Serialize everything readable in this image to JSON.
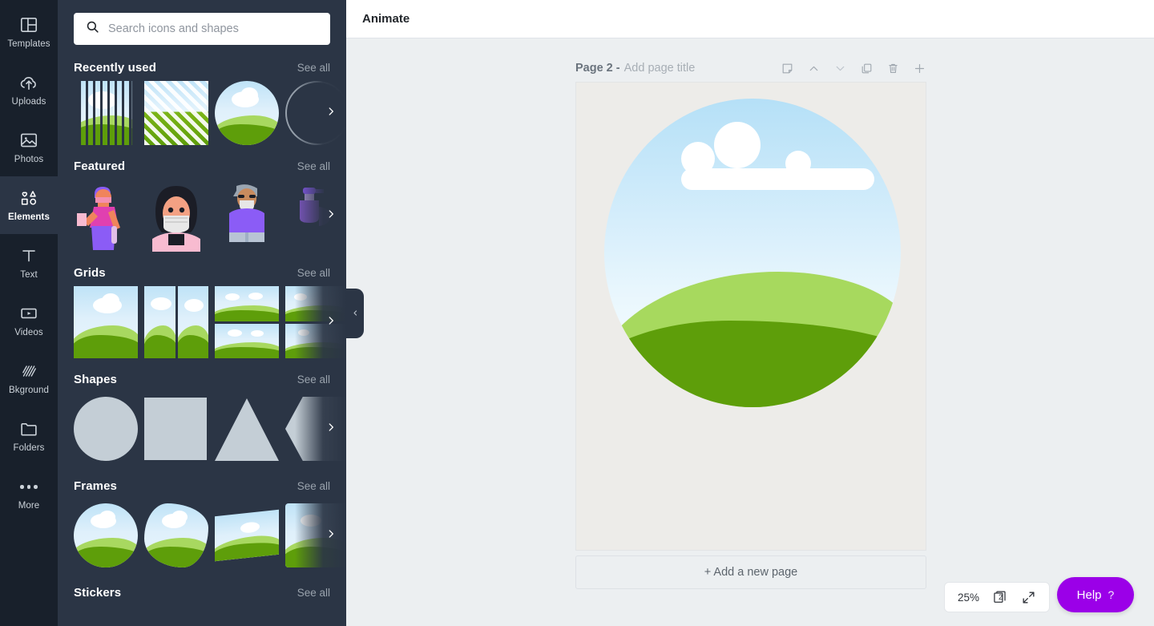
{
  "rail": {
    "items": [
      {
        "label": "Templates",
        "icon": "templates-icon",
        "active": false
      },
      {
        "label": "Uploads",
        "icon": "upload-cloud-icon",
        "active": false
      },
      {
        "label": "Photos",
        "icon": "photo-icon",
        "active": false
      },
      {
        "label": "Elements",
        "icon": "elements-shapes-icon",
        "active": true
      },
      {
        "label": "Text",
        "icon": "text-t-icon",
        "active": false
      },
      {
        "label": "Videos",
        "icon": "video-play-icon",
        "active": false
      },
      {
        "label": "Bkground",
        "icon": "background-hatch-icon",
        "active": false
      },
      {
        "label": "Folders",
        "icon": "folder-icon",
        "active": false
      },
      {
        "label": "More",
        "icon": "more-dots-icon",
        "active": false
      }
    ]
  },
  "panel": {
    "search": {
      "placeholder": "Search icons and shapes",
      "value": "",
      "icon": "search-icon"
    },
    "see_all_label": "See all",
    "sections": [
      {
        "title": "Recently used",
        "see_all": "See all"
      },
      {
        "title": "Featured",
        "see_all": "See all"
      },
      {
        "title": "Grids",
        "see_all": "See all"
      },
      {
        "title": "Shapes",
        "see_all": "See all"
      },
      {
        "title": "Frames",
        "see_all": "See all"
      },
      {
        "title": "Stickers",
        "see_all": "See all"
      }
    ],
    "collapse_icon": "chevron-left-icon",
    "scroll_next_icon": "chevron-right-icon"
  },
  "topbar": {
    "animate_label": "Animate"
  },
  "page": {
    "label": "Page 2 -",
    "title_placeholder": "Add page title",
    "tools": [
      {
        "name": "notes-icon",
        "title": "Notes"
      },
      {
        "name": "chevron-up-icon",
        "title": "Move page up"
      },
      {
        "name": "chevron-down-icon",
        "title": "Move page down"
      },
      {
        "name": "duplicate-icon",
        "title": "Duplicate page"
      },
      {
        "name": "trash-icon",
        "title": "Delete page"
      },
      {
        "name": "plus-icon",
        "title": "Add page"
      }
    ],
    "add_page_label": "+ Add a new page"
  },
  "controls": {
    "zoom_level": "25%",
    "page_count": "2",
    "pages_icon": "pages-stack-icon",
    "fullscreen_icon": "expand-arrows-icon",
    "help_label": "Help",
    "help_mark": "?"
  },
  "colors": {
    "rail_bg": "#18202b",
    "panel_bg": "#2b3545",
    "rail_active_bg": "#2b3545",
    "canvas_bg": "#eceff1",
    "page_bg": "#edece9",
    "help_purple": "#9b00e8",
    "sky_top": "#b5e0f7",
    "hill_light": "#a7d95e",
    "hill_dark": "#5e9e0a"
  }
}
